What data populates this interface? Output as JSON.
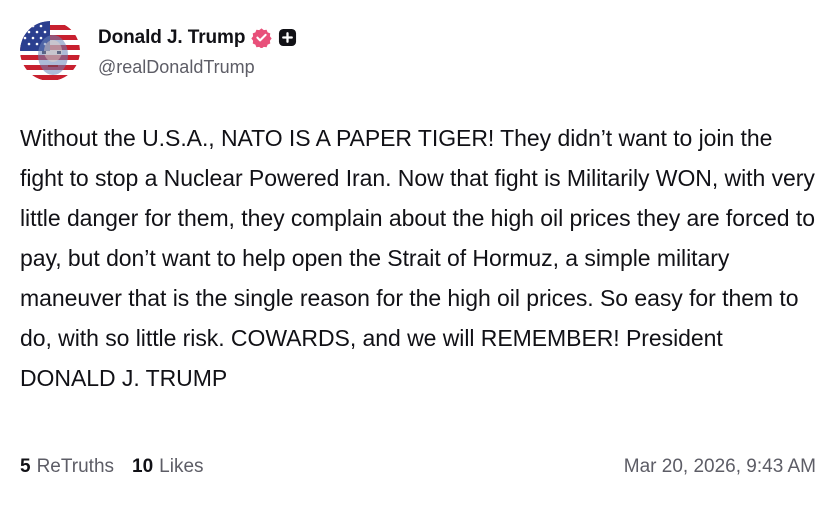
{
  "author": {
    "display_name": "Donald J. Trump",
    "handle": "@realDonaldTrump",
    "avatar_icon": "profile-photo-flag",
    "verified_icon": "verified-badge-icon",
    "verified_color": "#e8507a",
    "plus_icon": "plus-badge-icon"
  },
  "post": {
    "text": "Without the U.S.A., NATO IS A PAPER TIGER! They didn’t want to join the fight to stop a Nuclear Powered Iran. Now that fight is Militarily WON, with very little danger for them, they complain about the high oil prices they are forced to pay, but don’t want to help open the Strait of Hormuz, a simple military maneuver that is the single reason for the high oil prices. So easy for them to do, with so little risk. COWARDS, and we will REMEMBER! President DONALD J. TRUMP",
    "retruths_count": "5",
    "retruths_label": "ReTruths",
    "likes_count": "10",
    "likes_label": "Likes",
    "timestamp": "Mar 20, 2026, 9:43 AM"
  }
}
